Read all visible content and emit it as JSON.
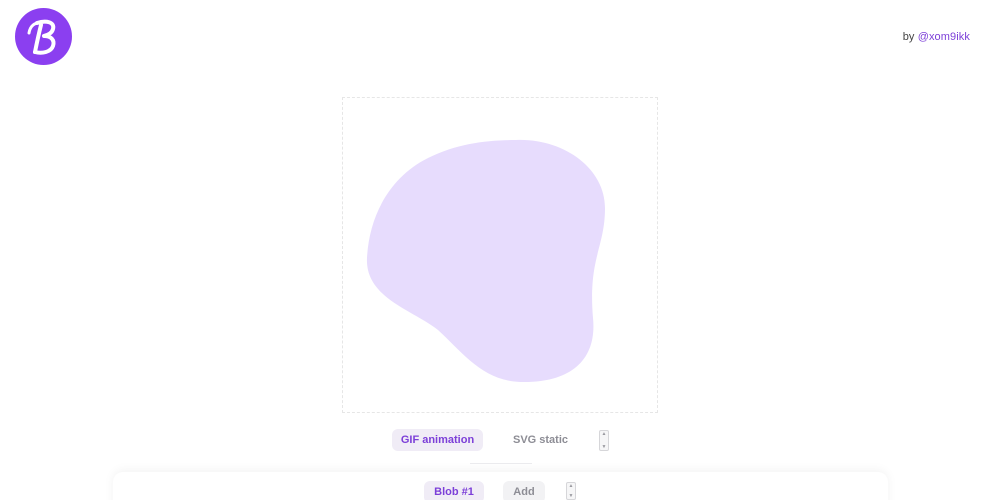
{
  "header": {
    "logo_letter": "B",
    "credit_prefix": "by ",
    "credit_handle": "@xom9ikk"
  },
  "colors": {
    "brand": "#8b3ff0",
    "accent_text": "#7c3fd8",
    "blob_fill": "#e7dcfd",
    "pill_active_bg": "#f0ecf6",
    "muted_text": "#8d8d95"
  },
  "export": {
    "options": [
      {
        "label": "GIF animation",
        "active": true
      },
      {
        "label": "SVG static",
        "active": false
      }
    ]
  },
  "blobs": {
    "tabs": [
      {
        "label": "Blob #1",
        "active": true
      },
      {
        "label": "Add",
        "active": false
      }
    ]
  }
}
